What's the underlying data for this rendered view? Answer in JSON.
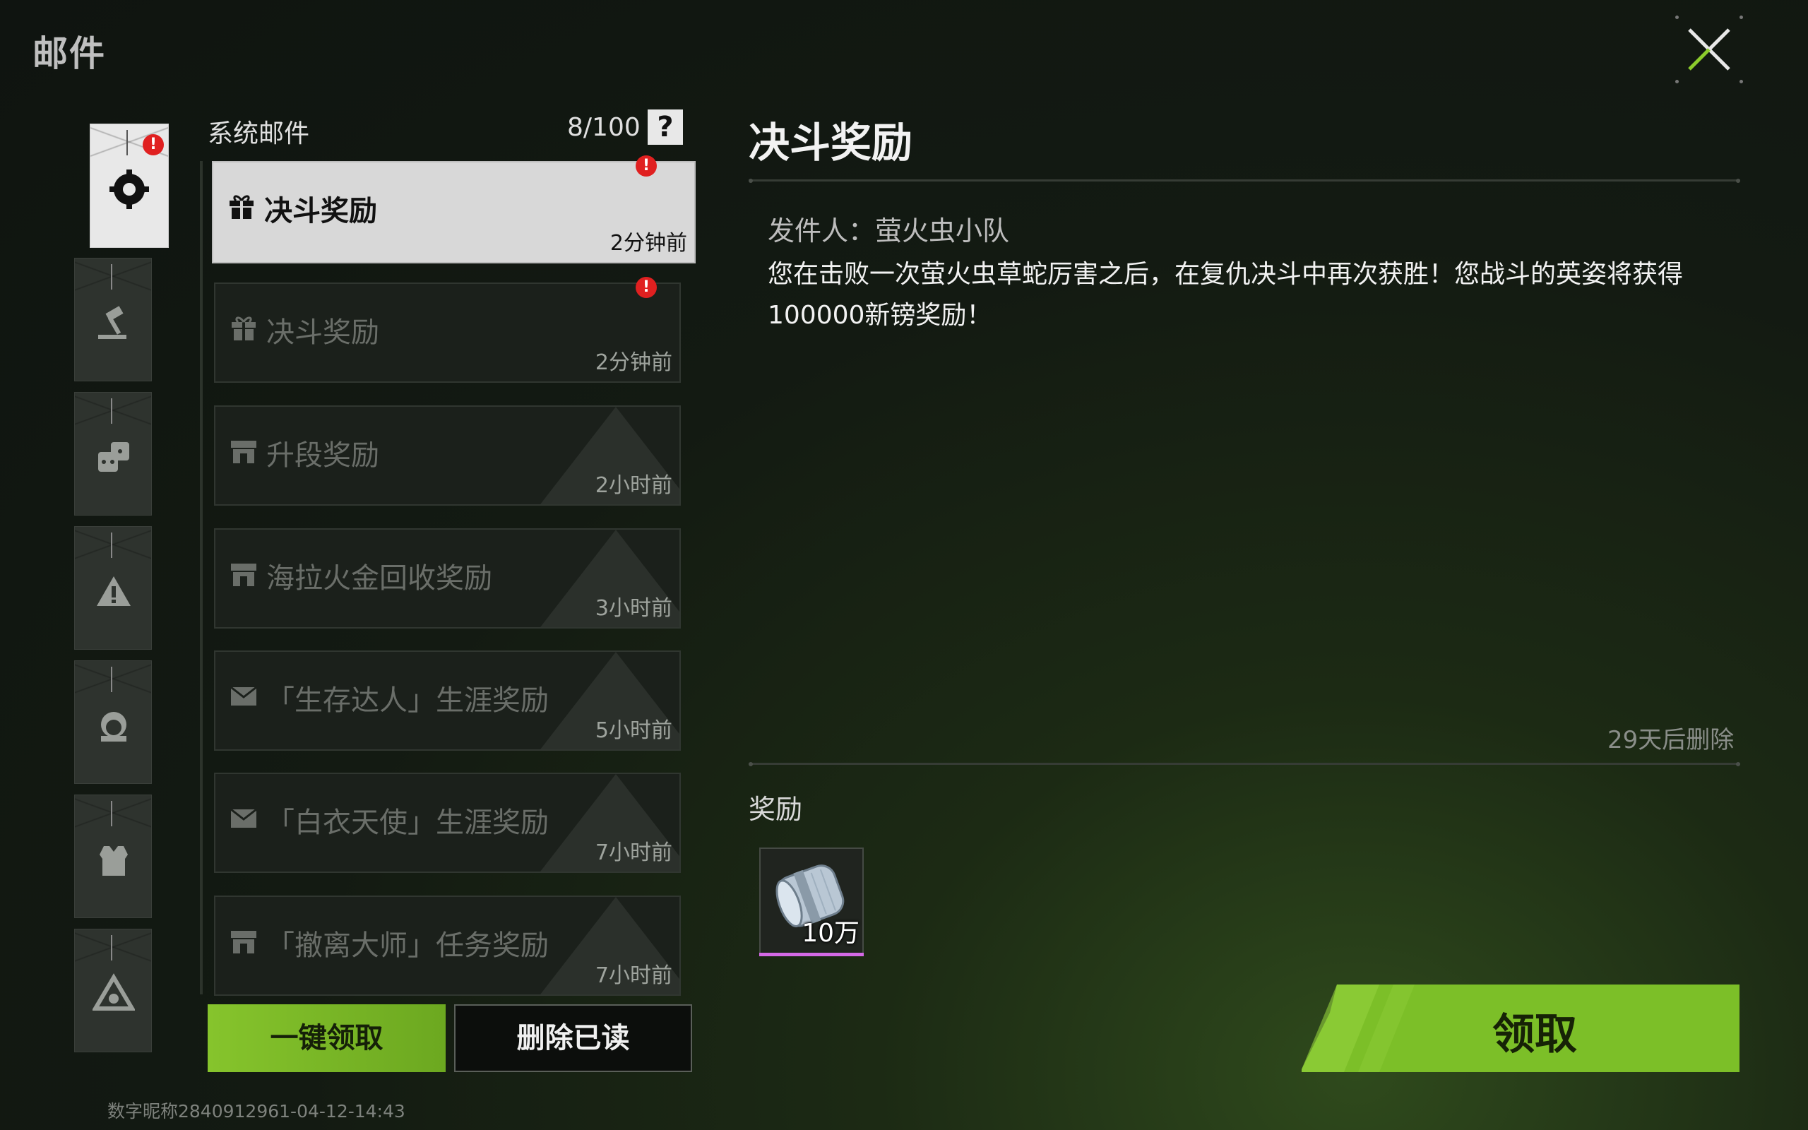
{
  "header": {
    "title": "邮件"
  },
  "categories": [
    {
      "name": "system",
      "active": true,
      "unread": true
    },
    {
      "name": "rank"
    },
    {
      "name": "activity"
    },
    {
      "name": "warning"
    },
    {
      "name": "character"
    },
    {
      "name": "armor"
    },
    {
      "name": "extract"
    }
  ],
  "list": {
    "title": "系统邮件",
    "count": "8/100",
    "help": "?",
    "items": [
      {
        "title": "决斗奖励",
        "time": "2分钟前",
        "icon": "gift-icon",
        "unread": true,
        "selected": true
      },
      {
        "title": "决斗奖励",
        "time": "2分钟前",
        "icon": "gift-icon",
        "unread": true
      },
      {
        "title": "升段奖励",
        "time": "2小时前",
        "icon": "shop-icon"
      },
      {
        "title": "海拉火金回收奖励",
        "time": "3小时前",
        "icon": "shop-icon"
      },
      {
        "title": "「生存达人」生涯奖励",
        "time": "5小时前",
        "icon": "envelope-icon"
      },
      {
        "title": "「白衣天使」生涯奖励",
        "time": "7小时前",
        "icon": "envelope-icon"
      },
      {
        "title": "「撤离大师」任务奖励",
        "time": "7小时前",
        "icon": "shop-icon"
      }
    ]
  },
  "actions": {
    "claim_all": "一键领取",
    "delete_read": "删除已读"
  },
  "footer": {
    "id": "数字昵称2840912961-04-12-14:43"
  },
  "detail": {
    "title": "决斗奖励",
    "sender": "发件人：萤火虫小队",
    "body": "您在击败一次萤火虫草蛇厉害之后，在复仇决斗中再次获胜！您战斗的英姿将获得100000新镑奖励！",
    "expire": "29天后删除",
    "reward_label": "奖励",
    "reward": {
      "name": "cash-bundle-icon",
      "qty": "10万"
    },
    "claim": "领取"
  },
  "colors": {
    "accent": "#7fbf2a",
    "unread": "#e02020",
    "rarity": "#d469e6"
  }
}
